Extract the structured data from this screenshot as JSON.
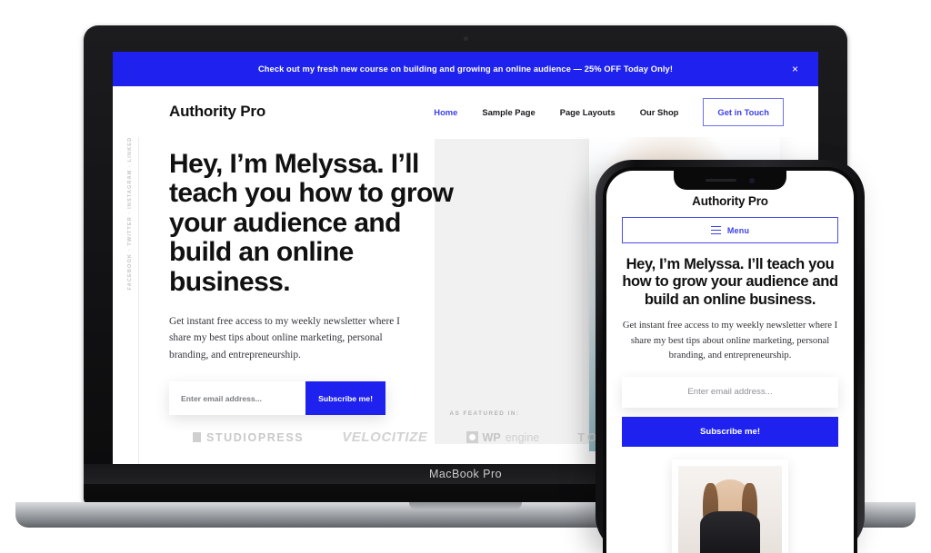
{
  "device_labels": {
    "laptop": "MacBook Pro"
  },
  "site": {
    "promo": {
      "text": "Check out my fresh new course on building and growing an online audience — 25% OFF Today Only!",
      "close_icon": "close-icon",
      "close_glyph": "×",
      "background": "#1f22ef"
    },
    "social_rail": {
      "text": "FACEBOOK  ·  TWITTER  ·  INSTAGRAM  ·  LINKEDIN"
    },
    "header": {
      "brand": "Authority Pro",
      "nav": [
        {
          "label": "Home",
          "active": true
        },
        {
          "label": "Sample Page",
          "active": false
        },
        {
          "label": "Page Layouts",
          "active": false
        },
        {
          "label": "Our Shop",
          "active": false
        }
      ],
      "cta_label": "Get in Touch"
    },
    "hero": {
      "title": "Hey, I’m Melyssa. I’ll teach you how to grow your audience and build an online business.",
      "copy": "Get instant free access to my weekly newsletter where I share my best tips about online marketing, personal branding, and entrepreneurship.",
      "email_placeholder": "Enter email address...",
      "subscribe_label": "Subscribe me!",
      "accent": "#1f22ef"
    },
    "featured": {
      "label": "AS FEATURED IN:",
      "logos": [
        {
          "name": "studiopress",
          "text": "STUDIOPRESS"
        },
        {
          "name": "velocitize",
          "text": "VELOCITIZE"
        },
        {
          "name": "wpengine",
          "bold": "WP",
          "light": "engine"
        },
        {
          "name": "torque",
          "text": "TORQ"
        }
      ]
    }
  },
  "phone": {
    "brand": "Authority Pro",
    "menu_label": "Menu",
    "menu_icon": "hamburger-icon",
    "title": "Hey, I’m Melyssa. I’ll teach you how to grow your audience and build an online business.",
    "copy": "Get instant free access to my weekly newsletter where I share my best tips about online marketing, personal branding, and entrepreneurship.",
    "email_placeholder": "Enter email address...",
    "subscribe_label": "Subscribe me!"
  }
}
